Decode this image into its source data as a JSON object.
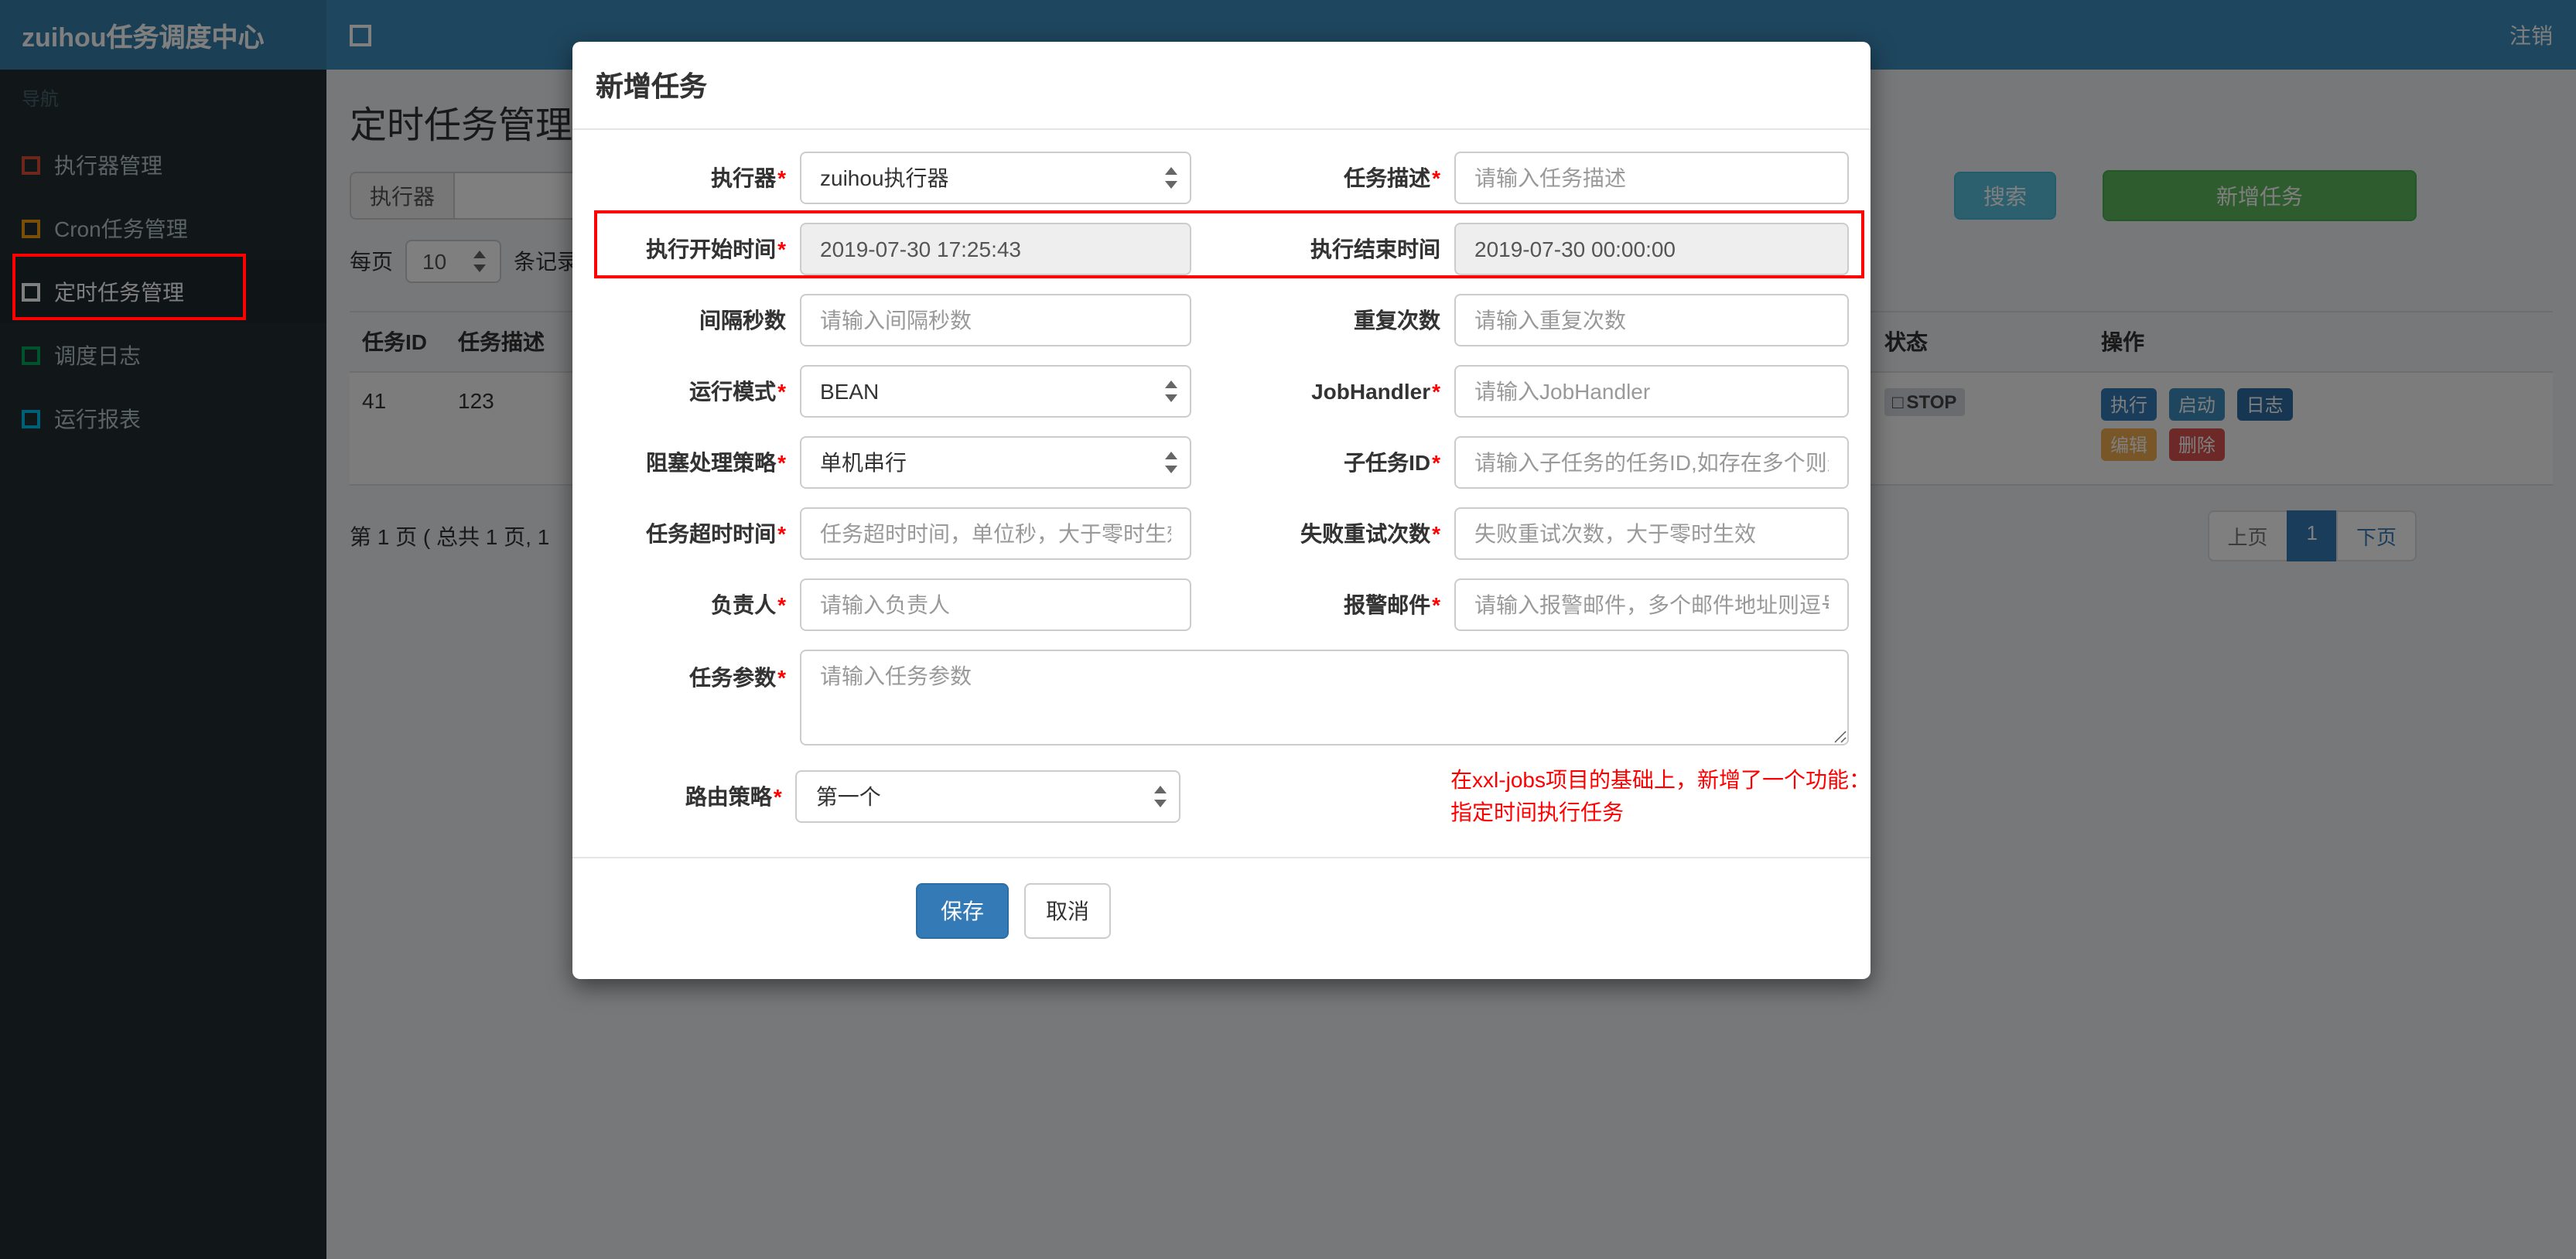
{
  "colors": {
    "annotation": "#ff0000",
    "header_bg": "#3c8dbc",
    "sidebar_bg": "#222d32",
    "save_btn": "#337ab7",
    "search_btn": "#5bc0de",
    "add_btn": "#5cb85c"
  },
  "header": {
    "brand": "zuihou任务调度中心",
    "logout_label": "注销"
  },
  "sidebar": {
    "section_label": "导航",
    "items": [
      {
        "label": "执行器管理",
        "icon_color": "#dd4b39"
      },
      {
        "label": "Cron任务管理",
        "icon_color": "#f39c12"
      },
      {
        "label": "定时任务管理",
        "icon_color": "#ffffff"
      },
      {
        "label": "调度日志",
        "icon_color": "#00a65a"
      },
      {
        "label": "运行报表",
        "icon_color": "#00c0ef"
      }
    ]
  },
  "content": {
    "page_title": "定时任务管理",
    "filter": {
      "executor_label": "执行器",
      "search_label": "搜索",
      "add_label": "新增任务"
    },
    "page_size": {
      "prefix": "每页",
      "value": "10",
      "suffix": "条记录"
    },
    "table": {
      "col_task_id": "任务ID",
      "col_desc": "任务描述",
      "col_status": "状态",
      "col_actions": "操作",
      "row": {
        "task_id": "41",
        "desc": "123",
        "status_icon": "□",
        "status": "STOP",
        "action_run": "执行",
        "action_start": "启动",
        "action_log": "日志",
        "action_edit": "编辑",
        "action_delete": "删除"
      }
    },
    "pagination": {
      "summary": "第 1 页 ( 总共 1 页, 1",
      "prev": "上页",
      "page": "1",
      "next": "下页"
    }
  },
  "modal": {
    "title": "新增任务",
    "required_marker": "*",
    "fields": {
      "executor": {
        "label": "执行器",
        "value": "zuihou执行器"
      },
      "desc": {
        "label": "任务描述",
        "placeholder": "请输入任务描述"
      },
      "start_time": {
        "label": "执行开始时间",
        "value": "2019-07-30 17:25:43"
      },
      "end_time": {
        "label": "执行结束时间",
        "value": "2019-07-30 00:00:00"
      },
      "interval": {
        "label": "间隔秒数",
        "placeholder": "请输入间隔秒数"
      },
      "repeat": {
        "label": "重复次数",
        "placeholder": "请输入重复次数"
      },
      "run_mode": {
        "label": "运行模式",
        "value": "BEAN"
      },
      "job_handler": {
        "label": "JobHandler",
        "placeholder": "请输入JobHandler"
      },
      "block_strategy": {
        "label": "阻塞处理策略",
        "value": "单机串行"
      },
      "child_job": {
        "label": "子任务ID",
        "placeholder": "请输入子任务的任务ID,如存在多个则逗号分隔"
      },
      "timeout": {
        "label": "任务超时时间",
        "placeholder": "任务超时时间，单位秒，大于零时生效"
      },
      "retry": {
        "label": "失败重试次数",
        "placeholder": "失败重试次数，大于零时生效"
      },
      "owner": {
        "label": "负责人",
        "placeholder": "请输入负责人"
      },
      "alarm_email": {
        "label": "报警邮件",
        "placeholder": "请输入报警邮件，多个邮件地址则逗号分隔"
      },
      "params": {
        "label": "任务参数",
        "placeholder": "请输入任务参数"
      },
      "route_strategy": {
        "label": "路由策略",
        "value": "第一个"
      }
    },
    "note_line1": "在xxl-jobs项目的基础上，新增了一个功能：",
    "note_line2": "指定时间执行任务",
    "save_label": "保存",
    "cancel_label": "取消"
  }
}
